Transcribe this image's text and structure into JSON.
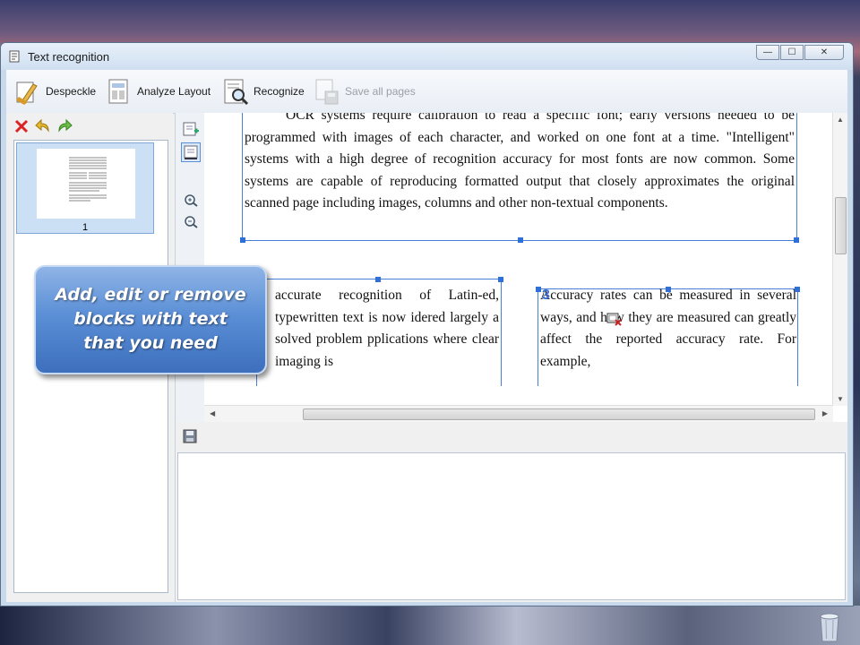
{
  "window": {
    "title": "Text recognition",
    "minimize_glyph": "—",
    "maximize_glyph": "☐",
    "close_glyph": "✕"
  },
  "toolbar": {
    "despeckle_label": "Despeckle",
    "analyze_label": "Analyze Layout",
    "recognize_label": "Recognize",
    "save_all_label": "Save all pages"
  },
  "pages_panel": {
    "thumb_number": "1"
  },
  "document": {
    "block1": "OCR systems require calibration to read a specific font; early versions needed to be programmed with images of each character, and worked on one font at a time. \"Intelligent\" systems with a high degree of recognition accuracy for most fonts are now common. Some systems are capable of reproducing formatted output that closely approximates the original scanned page including images, columns and other non-textual components.",
    "block2": "accurate recognition of Latin-ed, typewritten text is now idered largely a solved problem pplications where clear imaging is",
    "block3": "Accuracy rates can be measured in several ways, and how they are measured can greatly affect the reported accuracy rate. For example,",
    "block3_number": "3"
  },
  "callout": {
    "text": "Add, edit or remove\nblocks with text\nthat you need"
  },
  "icons": [
    "delete-icon",
    "undo-icon",
    "redo-icon",
    "add-block-icon",
    "select-block-icon",
    "zoom-in-icon",
    "zoom-out-icon",
    "save-text-icon",
    "trash-icon"
  ]
}
